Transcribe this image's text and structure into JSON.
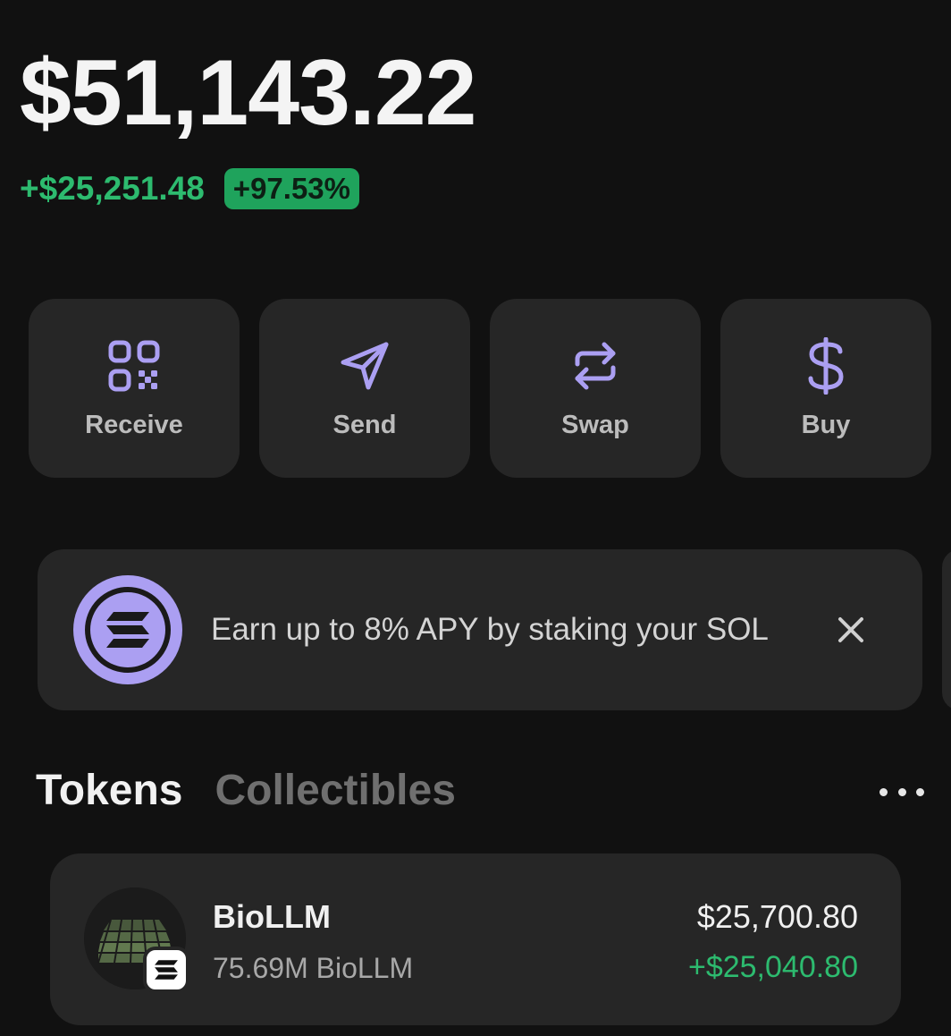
{
  "portfolio": {
    "balance": "$51,143.22",
    "change_amount": "+$25,251.48",
    "change_percent": "+97.53%"
  },
  "actions": [
    {
      "label": "Receive",
      "icon": "qr-code-icon"
    },
    {
      "label": "Send",
      "icon": "send-arrow-icon"
    },
    {
      "label": "Swap",
      "icon": "swap-arrows-icon"
    },
    {
      "label": "Buy",
      "icon": "dollar-icon"
    }
  ],
  "banner": {
    "text": "Earn up to 8% APY by staking your SOL",
    "icon": "solana-logo-icon",
    "close_icon": "close-icon"
  },
  "tabs": [
    {
      "label": "Tokens",
      "active": true
    },
    {
      "label": "Collectibles",
      "active": false
    }
  ],
  "more_icon": "more-dots-icon",
  "tokens": [
    {
      "name": "BioLLM",
      "amount": "75.69M BioLLM",
      "value": "$25,700.80",
      "change": "+$25,040.80",
      "chain_icon": "solana-chain-icon"
    }
  ],
  "colors": {
    "background": "#111111",
    "card": "#262626",
    "accent": "#ab9ff2",
    "positive": "#2dbb6f",
    "badge": "#1fa35c"
  }
}
